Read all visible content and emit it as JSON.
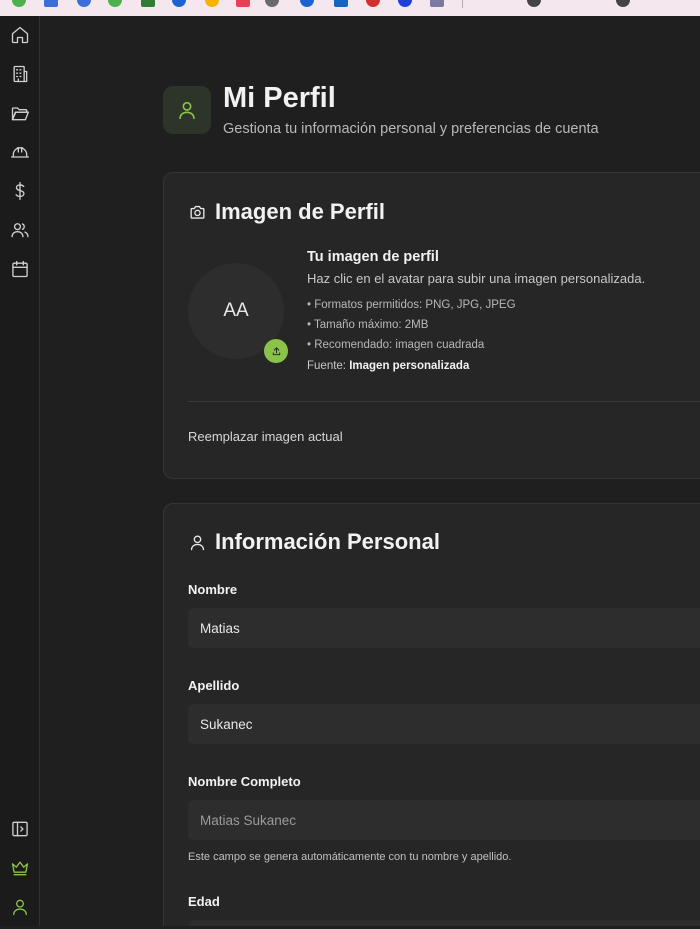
{
  "bookmarks_bar": {
    "colors": [
      "#4caf50",
      "#3b6fd6",
      "#3b6fd6",
      "#4caf50",
      "#2e7d32",
      "#1e62d0",
      "#f4b400",
      "#e94057",
      "#6a6a6a",
      "#1e62d0",
      "#1565c0",
      "#d32f2f",
      "#1e40d8",
      "#7a7aa0",
      "#444444",
      "#444444"
    ]
  },
  "sidebar": {
    "items": [
      {
        "icon": "home-icon"
      },
      {
        "icon": "building-icon"
      },
      {
        "icon": "folder-icon"
      },
      {
        "icon": "hard-hat-icon"
      },
      {
        "icon": "dollar-icon"
      },
      {
        "icon": "users-icon"
      },
      {
        "icon": "calendar-icon"
      }
    ],
    "bottom_items": [
      {
        "icon": "panel-toggle-icon"
      },
      {
        "icon": "crown-icon"
      },
      {
        "icon": "user-icon"
      }
    ],
    "accent_color": "#8bc34a"
  },
  "header": {
    "title": "Mi Perfil",
    "subtitle": "Gestiona tu información personal y preferencias de cuenta"
  },
  "profile_image": {
    "title": "Imagen de Perfil",
    "avatar_initials": "AA",
    "info_title": "Tu imagen de perfil",
    "info_desc": "Haz clic en el avatar para subir una imagen personalizada.",
    "bullets": [
      "• Formatos permitidos: PNG, JPG, JPEG",
      "• Tamaño máximo: 2MB",
      "• Recomendado: imagen cuadrada"
    ],
    "source_label": "Fuente:",
    "source_value": "Imagen personalizada",
    "replace_link": "Reemplazar imagen actual"
  },
  "personal_info": {
    "title": "Información Personal",
    "first_name_label": "Nombre",
    "first_name_value": "Matias",
    "last_name_label": "Apellido",
    "last_name_value": "Sukanec",
    "full_name_label": "Nombre Completo",
    "full_name_value": "Matias Sukanec",
    "full_name_hint": "Este campo se genera automáticamente con tu nombre y apellido.",
    "age_label": "Edad"
  }
}
